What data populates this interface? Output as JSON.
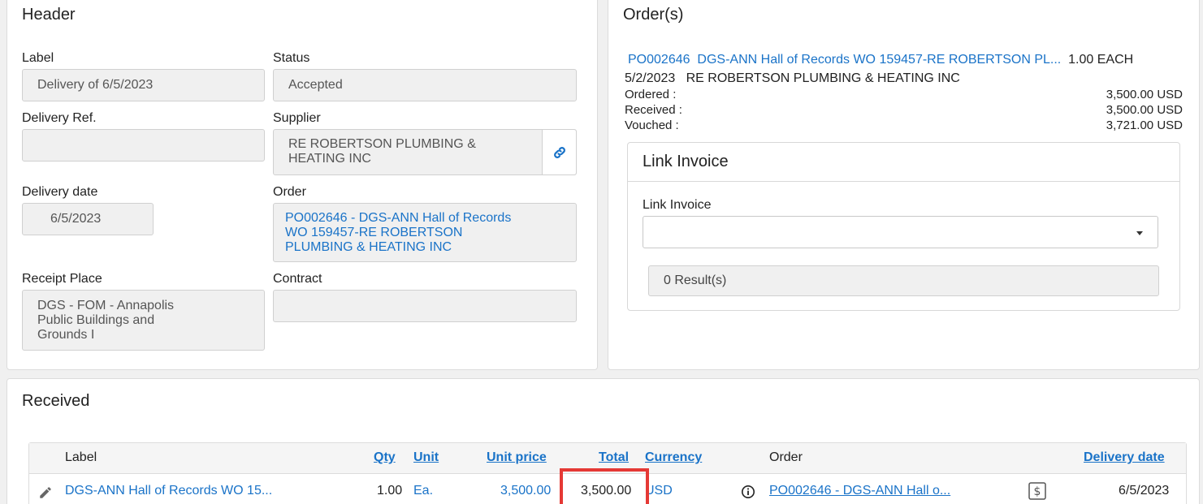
{
  "header": {
    "title": "Header",
    "label": {
      "caption": "Label",
      "value": "Delivery of 6/5/2023"
    },
    "status": {
      "caption": "Status",
      "value": "Accepted"
    },
    "delivery_ref": {
      "caption": "Delivery Ref.",
      "value": ""
    },
    "supplier": {
      "caption": "Supplier",
      "line1": "RE ROBERTSON PLUMBING &",
      "line2": "HEATING INC"
    },
    "delivery_date": {
      "caption": "Delivery date",
      "value": "6/5/2023"
    },
    "order": {
      "caption": "Order",
      "line1": "PO002646 - DGS-ANN Hall of Records",
      "line2": "WO 159457-RE ROBERTSON",
      "line3": "PLUMBING & HEATING INC"
    },
    "receipt_place": {
      "caption": "Receipt Place",
      "line1": "DGS - FOM - Annapolis",
      "line2": "Public Buildings and",
      "line3": "Grounds I"
    },
    "contract": {
      "caption": "Contract",
      "value": ""
    }
  },
  "orders": {
    "title": "Order(s)",
    "po_number": "PO002646",
    "po_desc": "DGS-ANN Hall of Records WO 159457-RE ROBERTSON PL...",
    "qty_unit": "1.00 EACH",
    "date": "5/2/2023",
    "supplier": "RE ROBERTSON PLUMBING & HEATING INC",
    "ordered_label": "Ordered :",
    "ordered_value": "3,500.00 USD",
    "received_label": "Received :",
    "received_value": "3,500.00 USD",
    "vouched_label": "Vouched :",
    "vouched_value": "3,721.00 USD",
    "link_invoice": {
      "title": "Link Invoice",
      "field_label": "Link Invoice",
      "value": "",
      "results": "0 Result(s)"
    }
  },
  "received": {
    "title": "Received",
    "columns": {
      "label": "Label",
      "qty": "Qty",
      "unit": "Unit",
      "unit_price": "Unit price",
      "total": "Total",
      "currency": "Currency",
      "order": "Order",
      "delivery_date": "Delivery date"
    },
    "rows": [
      {
        "label": "DGS-ANN Hall of Records WO 15...",
        "qty": "1.00",
        "unit": "Ea.",
        "unit_price": "3,500.00",
        "total": "3,500.00",
        "currency": "USD",
        "order": "PO002646 - DGS-ANN Hall o...",
        "delivery_date": "6/5/2023"
      }
    ]
  },
  "colors": {
    "link": "#1a73c8",
    "highlight": "#e53935"
  },
  "icons": [
    "link-icon",
    "dropdown-caret-icon",
    "edit-pencil-icon",
    "info-icon",
    "dollar-icon"
  ]
}
